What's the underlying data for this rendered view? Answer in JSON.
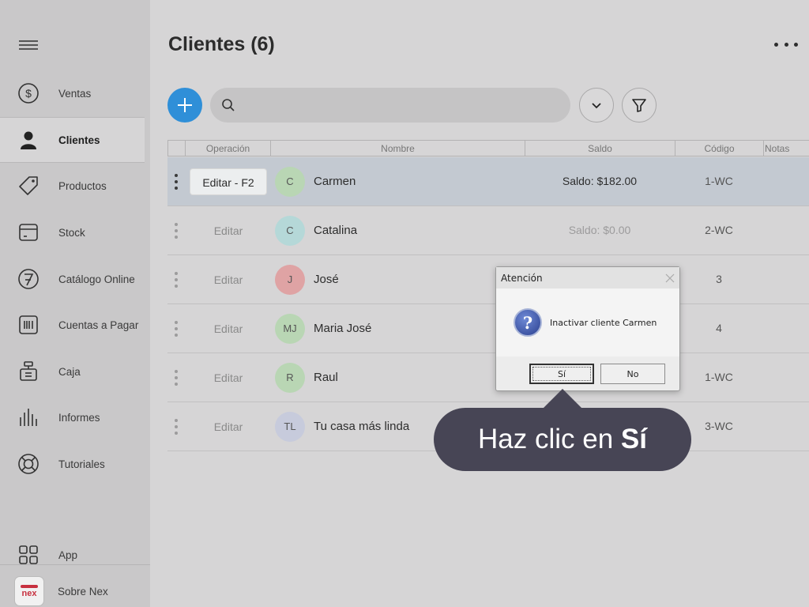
{
  "sidebar": {
    "items": [
      {
        "label": "Ventas",
        "icon": "dollar-circle-icon"
      },
      {
        "label": "Clientes",
        "icon": "person-icon",
        "active": true
      },
      {
        "label": "Productos",
        "icon": "tag-icon"
      },
      {
        "label": "Stock",
        "icon": "box-icon"
      },
      {
        "label": "Catálogo Online",
        "icon": "catalog-icon"
      },
      {
        "label": "Cuentas a Pagar",
        "icon": "barcode-icon"
      },
      {
        "label": "Caja",
        "icon": "cash-register-icon"
      },
      {
        "label": "Informes",
        "icon": "bar-chart-icon"
      },
      {
        "label": "Tutoriales",
        "icon": "lifebuoy-icon"
      }
    ],
    "app_label": "App",
    "about_label": "Sobre Nex",
    "logo_text": "nex"
  },
  "header": {
    "title": "Clientes (6)"
  },
  "search": {
    "placeholder": ""
  },
  "table": {
    "columns": [
      "Operación",
      "Nombre",
      "Saldo",
      "Código",
      "Notas"
    ],
    "rows": [
      {
        "edit": "Editar - F2",
        "initials": "C",
        "name": "Carmen",
        "saldo": "Saldo: $182.00",
        "code": "1-WC",
        "avatar_color": "#b9d6b4"
      },
      {
        "edit": "Editar",
        "initials": "C",
        "name": "Catalina",
        "saldo": "Saldo: $0.00",
        "code": "2-WC",
        "avatar_color": "#b5d8d8"
      },
      {
        "edit": "Editar",
        "initials": "J",
        "name": "José",
        "saldo": "",
        "code": "3",
        "avatar_color": "#dfa3a4"
      },
      {
        "edit": "Editar",
        "initials": "MJ",
        "name": "Maria José",
        "saldo": "",
        "code": "4",
        "avatar_color": "#b9d6b4"
      },
      {
        "edit": "Editar",
        "initials": "R",
        "name": "Raul",
        "saldo": "",
        "code": "1-WC",
        "avatar_color": "#b9d6b4"
      },
      {
        "edit": "Editar",
        "initials": "TL",
        "name": "Tu casa más linda",
        "saldo": "",
        "code": "3-WC",
        "avatar_color": "#c7cbdc"
      }
    ]
  },
  "dialog": {
    "title": "Atención",
    "message": "Inactivar cliente Carmen",
    "yes_label": "Sí",
    "no_label": "No"
  },
  "tooltip": {
    "prefix": "Haz clic en ",
    "bold": "Sí"
  },
  "colors": {
    "accent": "#2f8fd8",
    "tooltip_bg": "#474555",
    "selected_row": "#c3c9d1"
  }
}
